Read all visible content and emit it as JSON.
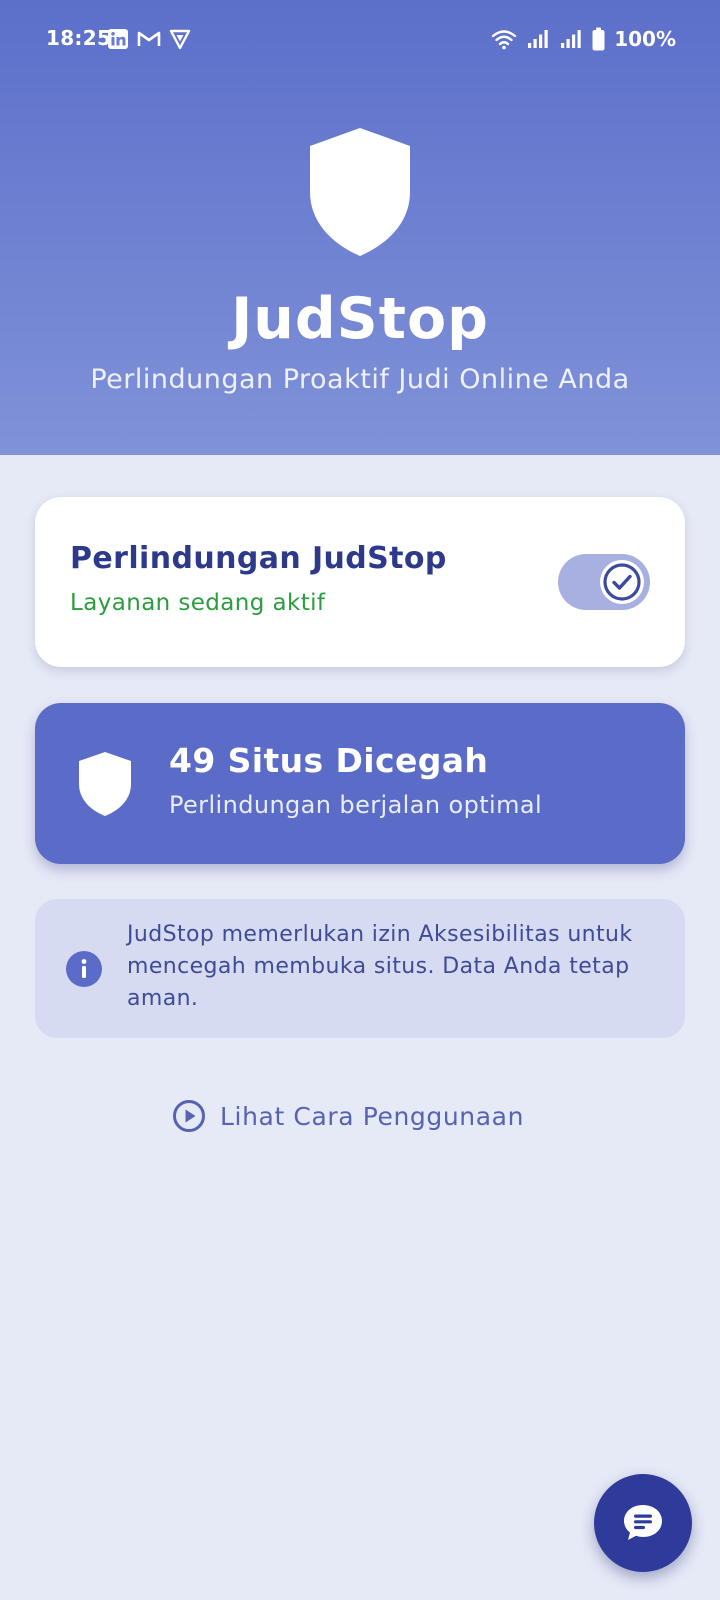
{
  "status_bar": {
    "time": "18:25",
    "left_icons": [
      "linkedin-icon",
      "gmail-icon",
      "vpn-shield-icon"
    ],
    "right_icons": [
      "wifi-icon",
      "signal-icon",
      "signal-icon",
      "battery-icon"
    ],
    "battery": "100%"
  },
  "header": {
    "icon": "shield-icon",
    "title": "JudStop",
    "subtitle": "Perlindungan Proaktif Judi Online Anda"
  },
  "protection_card": {
    "title": "Perlindungan JudStop",
    "status": "Layanan sedang aktif",
    "toggle_on": true
  },
  "stats_card": {
    "icon": "shield-icon",
    "count_label": "49 Situs Dicegah",
    "description": "Perlindungan berjalan optimal"
  },
  "info": {
    "icon": "info-icon",
    "text": "JudStop memerlukan izin Aksesibilitas untuk mencegah membuka situs. Data Anda tetap aman."
  },
  "howto": {
    "icon": "play-circle-icon",
    "label": "Lihat Cara Penggunaan"
  },
  "fab": {
    "icon": "chat-icon"
  },
  "colors": {
    "header_top": "#5c6fca",
    "header_bottom": "#8092d8",
    "background": "#e6e9f6",
    "title_dark": "#2d3a8c",
    "active_green": "#2a9d3c",
    "stats_card": "#5a6bc8",
    "info_bg": "#d6dbf2",
    "fab": "#2e3b9b"
  }
}
